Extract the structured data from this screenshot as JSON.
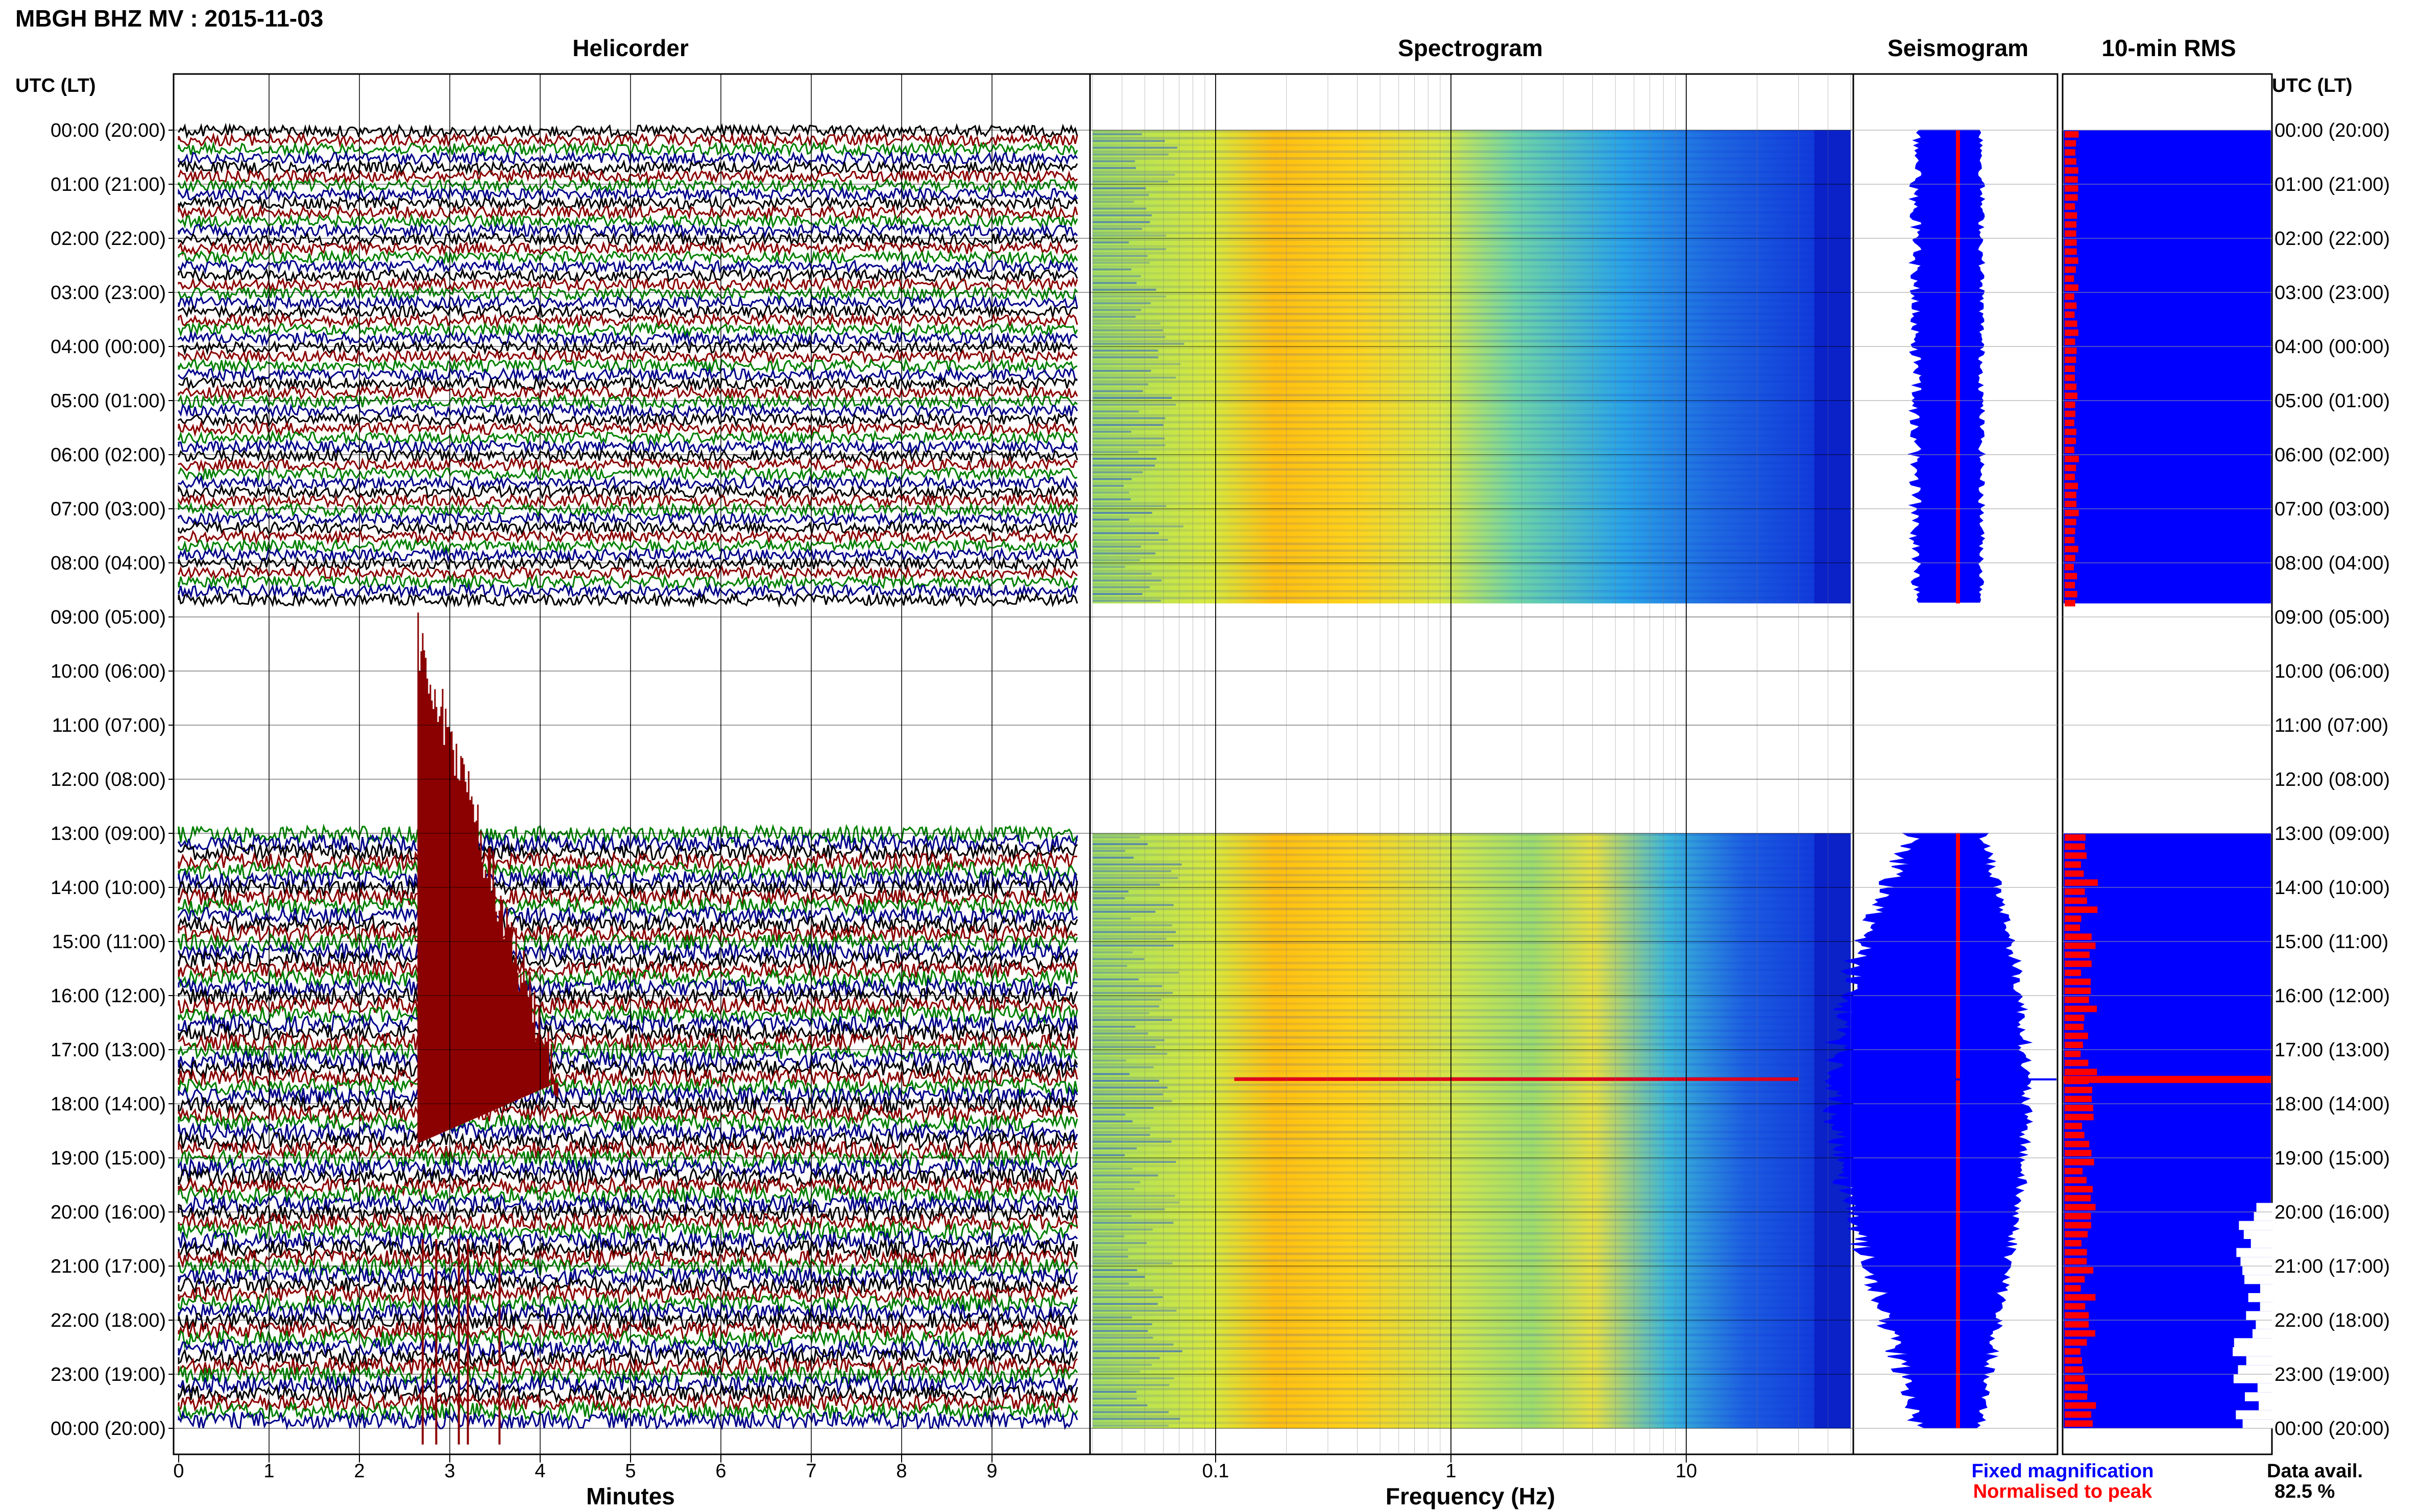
{
  "header": {
    "title": "MBGH BHZ MV : 2015-11-03"
  },
  "panels": {
    "helicorder": "Helicorder",
    "spectrogram": "Spectrogram",
    "seismogram": "Seismogram",
    "rms": "10-min RMS"
  },
  "axes": {
    "time_label_left": "UTC (LT)",
    "time_label_right": "UTC (LT)",
    "minutes_label": "Minutes",
    "frequency_label": "Frequency (Hz)"
  },
  "legend": {
    "fixed": "Fixed magnification",
    "normalised": "Normalised to peak",
    "data_avail_label": "Data avail.",
    "data_avail_value": "82.5 %"
  },
  "colors": {
    "blue": "#0000ff",
    "red": "#ff0000",
    "trace_black": "#000000",
    "trace_maroon": "#8b0000",
    "trace_green": "#008000",
    "trace_navy": "#00008b"
  },
  "chart_data": {
    "type": "helicorder",
    "time_ticks": [
      "00:00 (20:00)",
      "01:00 (21:00)",
      "02:00 (22:00)",
      "03:00 (23:00)",
      "04:00 (00:00)",
      "05:00 (01:00)",
      "06:00 (02:00)",
      "07:00 (03:00)",
      "08:00 (04:00)",
      "09:00 (05:00)",
      "10:00 (06:00)",
      "11:00 (07:00)",
      "12:00 (08:00)",
      "13:00 (09:00)",
      "14:00 (10:00)",
      "15:00 (11:00)",
      "16:00 (12:00)",
      "17:00 (13:00)",
      "18:00 (14:00)",
      "19:00 (15:00)",
      "20:00 (16:00)",
      "21:00 (17:00)",
      "22:00 (18:00)",
      "23:00 (19:00)",
      "00:00 (20:00)"
    ],
    "minute_ticks": [
      "0",
      "1",
      "2",
      "3",
      "4",
      "5",
      "6",
      "7",
      "8",
      "9"
    ],
    "minute_range": [
      0,
      10
    ],
    "frequency_ticks": [
      "0.1",
      "1",
      "10"
    ],
    "frequency_range": [
      0.03,
      50
    ],
    "frequency_scale": "log",
    "data_gaps_utc_hours": [
      [
        8.75,
        13.0
      ]
    ],
    "event": {
      "start_utc_hour": 8.75,
      "start_minute": 2.65,
      "peak_utc_hour": 17.55
    }
  }
}
